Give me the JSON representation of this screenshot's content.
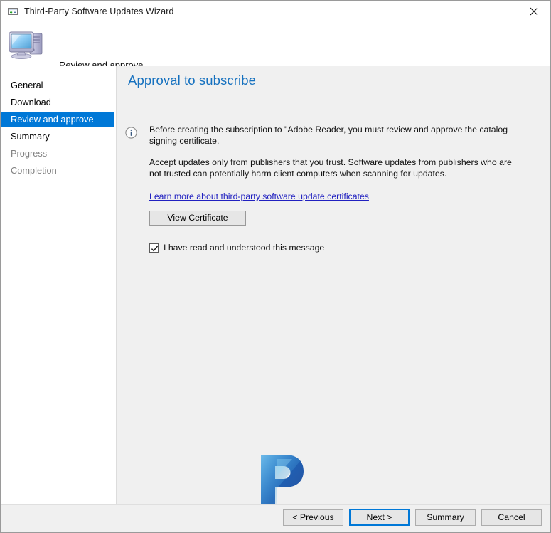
{
  "window": {
    "title": "Third-Party Software Updates Wizard",
    "title_icon": "wizard-window-icon",
    "close_label": "✕"
  },
  "wizard_header": {
    "title": "Review and approve",
    "icon": "computer-icon"
  },
  "sidebar": {
    "items": [
      {
        "label": "General",
        "state": "normal"
      },
      {
        "label": "Download",
        "state": "normal"
      },
      {
        "label": "Review and approve",
        "state": "selected"
      },
      {
        "label": "Summary",
        "state": "normal"
      },
      {
        "label": "Progress",
        "state": "disabled"
      },
      {
        "label": "Completion",
        "state": "disabled"
      }
    ]
  },
  "content": {
    "page_title": "Approval to subscribe",
    "info_icon": "info-icon",
    "paragraph_1": "Before creating the subscription to \"Adobe Reader, you must review and approve the catalog signing certificate.",
    "paragraph_2": "Accept updates only from publishers that you trust. Software updates from publishers who are not trusted can potentially harm client computers when scanning for updates.",
    "link_text": "Learn more about third-party software update certificates",
    "view_certificate_label": "View Certificate",
    "checkbox_label": "I have read and understood this message",
    "checkbox_checked": true
  },
  "watermark": {
    "letter": "P"
  },
  "footer": {
    "previous_label": "< Previous",
    "next_label": "Next >",
    "summary_label": "Summary",
    "cancel_label": "Cancel"
  },
  "colors": {
    "accent": "#0078d7",
    "page_title": "#1671bf",
    "link": "#2020c0",
    "content_bg": "#f0f0f0",
    "sidebar_bg": "#ffffff",
    "disabled_text": "#808080"
  }
}
